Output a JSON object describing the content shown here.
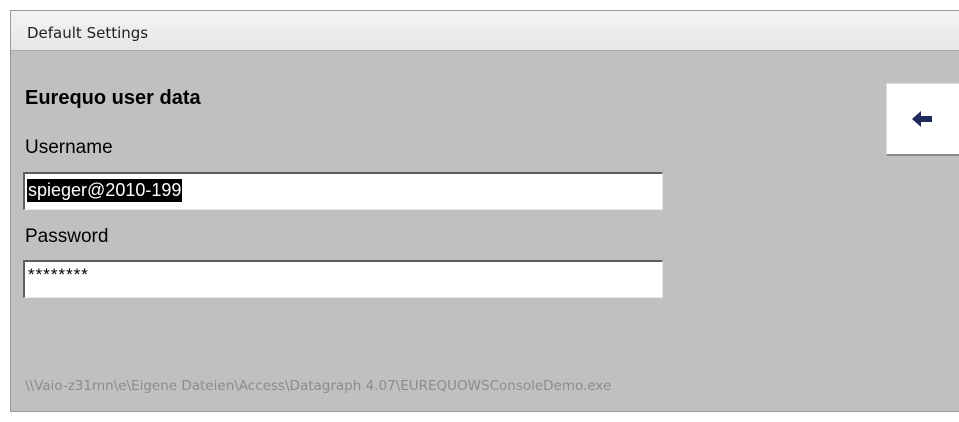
{
  "window": {
    "title": "Default Settings"
  },
  "form": {
    "heading": "Eurequo user data",
    "username_label": "Username",
    "username_value": "spieger@2010-199",
    "password_label": "Password",
    "password_mask": "********"
  },
  "toolbar": {
    "back_icon": "arrow-left-icon"
  },
  "footer": {
    "path": "\\\\Vaio-z31mn\\e\\Eigene Dateien\\Access\\Datagraph 4.07\\EUREQUOWSConsoleDemo.exe"
  },
  "colors": {
    "window_background": "#c0c0c0",
    "selection_background": "#000000",
    "arrow": "#1f2a5c"
  }
}
